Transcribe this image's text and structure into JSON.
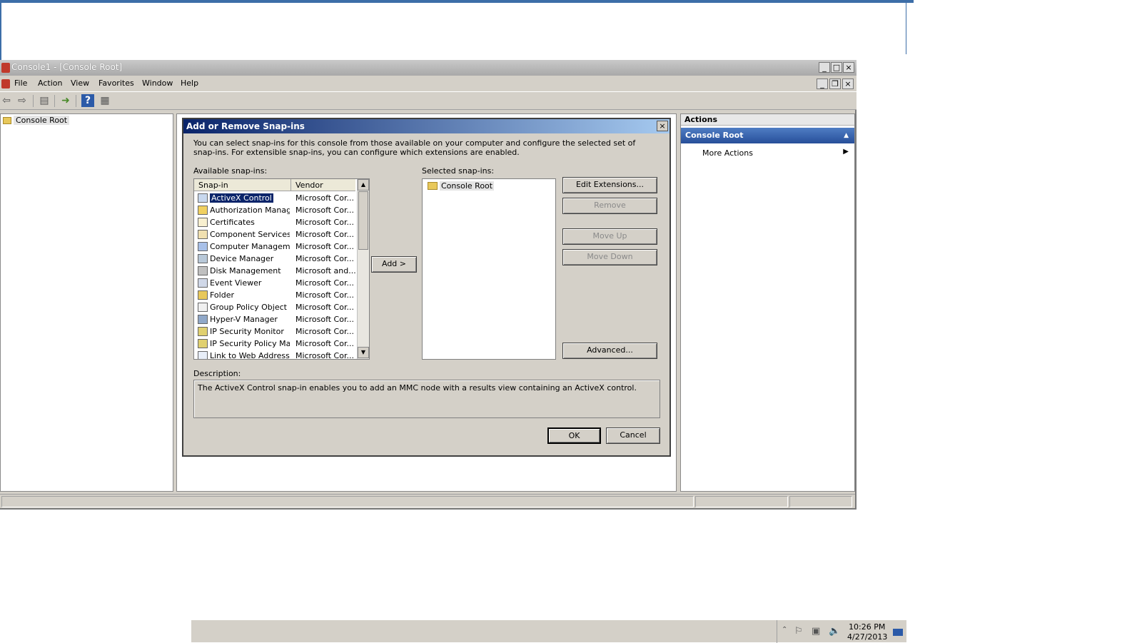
{
  "window": {
    "title": "Console1 - [Console Root]",
    "minimize": "_",
    "maximize": "□",
    "close": "×",
    "child_restore": "❐"
  },
  "menu": [
    "File",
    "Action",
    "View",
    "Favorites",
    "Window",
    "Help"
  ],
  "tree": {
    "root": "Console Root"
  },
  "actions": {
    "header": "Actions",
    "group": "Console Root",
    "item": "More Actions"
  },
  "dialog": {
    "title": "Add or Remove Snap-ins",
    "intro": "You can select snap-ins for this console from those available on your computer and configure the selected set of snap-ins. For extensible snap-ins, you can configure which extensions are enabled.",
    "available_label": "Available snap-ins:",
    "selected_label": "Selected snap-ins:",
    "columns": [
      "Snap-in",
      "Vendor"
    ],
    "snapins": [
      {
        "name": "ActiveX Control",
        "vendor": "Microsoft Cor..."
      },
      {
        "name": "Authorization Manager",
        "vendor": "Microsoft Cor..."
      },
      {
        "name": "Certificates",
        "vendor": "Microsoft Cor..."
      },
      {
        "name": "Component Services",
        "vendor": "Microsoft Cor..."
      },
      {
        "name": "Computer Managem...",
        "vendor": "Microsoft Cor..."
      },
      {
        "name": "Device Manager",
        "vendor": "Microsoft Cor..."
      },
      {
        "name": "Disk Management",
        "vendor": "Microsoft and..."
      },
      {
        "name": "Event Viewer",
        "vendor": "Microsoft Cor..."
      },
      {
        "name": "Folder",
        "vendor": "Microsoft Cor..."
      },
      {
        "name": "Group Policy Object ...",
        "vendor": "Microsoft Cor..."
      },
      {
        "name": "Hyper-V Manager",
        "vendor": "Microsoft Cor..."
      },
      {
        "name": "IP Security Monitor",
        "vendor": "Microsoft Cor..."
      },
      {
        "name": "IP Security Policy Ma...",
        "vendor": "Microsoft Cor..."
      },
      {
        "name": "Link to Web Address",
        "vendor": "Microsoft Cor..."
      }
    ],
    "selected_item": "Console Root",
    "add_button": "Add >",
    "edit_extensions": "Edit Extensions...",
    "remove": "Remove",
    "move_up": "Move Up",
    "move_down": "Move Down",
    "advanced": "Advanced...",
    "description_label": "Description:",
    "description": "The ActiveX Control snap-in enables you to add an MMC node with a results view containing an ActiveX control.",
    "ok": "OK",
    "cancel": "Cancel"
  },
  "taskbar": {
    "time": "10:26 PM",
    "date": "4/27/2013"
  }
}
